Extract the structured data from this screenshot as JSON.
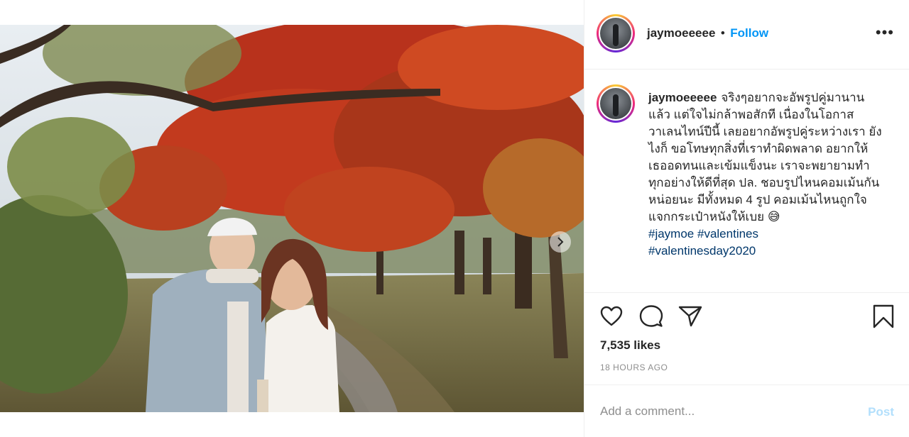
{
  "post": {
    "username": "jaymoeeeee",
    "bullet": "•",
    "follow_label": "Follow",
    "more_label": "•••",
    "caption": {
      "username": "jaymoeeeee",
      "text": "จริงๆอยากจะอัพรูปคู่มานานแล้ว แต่ใจไม่กล้าพอสักที เนื่องในโอกาสวาเลนไทน์ปีนี้ เลยอยากอัพรูปคู่ระหว่างเรา ยังไงก็ ขอโทษทุกสิ่งที่เราทำผิดพลาด อยากให้เธออดทนและเข้มแข็งนะ เราจะพยายามทำทุกอย่างให้ดีที่สุด ปล. ชอบรูปไหนคอมเม้นกันหน่อยนะ มีทั้งหมด 4 รูป คอมเม้นไหนถูกใจ แจกกระเป๋าหนังให้เบย",
      "emoji": "😅",
      "hashtags": [
        "#jaymoe",
        "#valentines",
        "#valentinesday2020"
      ]
    },
    "likes": "7,535 likes",
    "time_ago": "18 HOURS AGO",
    "carousel": {
      "total": 4,
      "current": 1
    }
  },
  "comment": {
    "placeholder": "Add a comment...",
    "post_label": "Post"
  },
  "icons": [
    "heart-icon",
    "comment-icon",
    "share-icon",
    "bookmark-icon",
    "more-icon",
    "next-arrow-icon"
  ],
  "colors": {
    "link_blue": "#0095f6",
    "hashtag": "#00376b",
    "muted": "#8e8e8e",
    "post_disabled": "#b2dffc"
  }
}
